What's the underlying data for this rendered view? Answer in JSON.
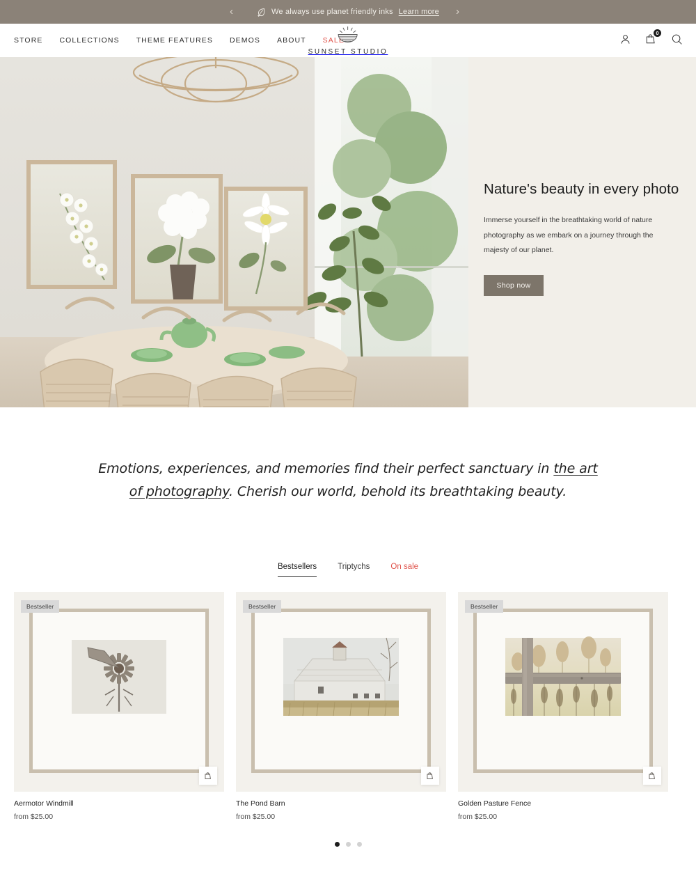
{
  "announcement": {
    "icon": "leaf-icon",
    "text": "We always use planet friendly inks",
    "link_label": "Learn more",
    "prev": "‹",
    "next": "›",
    "bg_color": "#8b8278"
  },
  "header": {
    "nav": [
      {
        "label": "STORE"
      },
      {
        "label": "COLLECTIONS"
      },
      {
        "label": "THEME FEATURES"
      },
      {
        "label": "DEMOS"
      },
      {
        "label": "ABOUT"
      },
      {
        "label": "SALE",
        "accent": "#e0544c"
      }
    ],
    "brand": {
      "name": "SUNSET STUDIO",
      "logo_icon": "sunset-logo-icon"
    },
    "actions": {
      "account_icon": "account-icon",
      "cart_icon": "cart-icon",
      "cart_count": "0",
      "search_icon": "search-icon"
    }
  },
  "hero": {
    "image_alt": "Dining room with three framed white flower photographs, rattan chairs and a green plant by the window",
    "title": "Nature's beauty in every photo",
    "subtitle": "Immerse yourself in the breathtaking world of nature photography as we embark on a journey through the majesty of our planet.",
    "cta_label": "Shop now",
    "bg_color": "#f2efe9",
    "cta_color": "#7d756a"
  },
  "quote": {
    "part1": "Emotions, experiences, and memories find their perfect sanctuary in ",
    "underlined": "the art of photography",
    "part2": ". Cherish our world, behold its breathtaking beauty."
  },
  "tabs": [
    {
      "label": "Bestsellers",
      "active": true
    },
    {
      "label": "Triptychs",
      "active": false
    },
    {
      "label": "On sale",
      "active": false,
      "accent": "#e0544c"
    }
  ],
  "products": [
    {
      "badge": "Bestseller",
      "title": "Aermotor Windmill",
      "price": "from $25.00",
      "image_alt": "Framed photograph of a vintage metal windmill against a pale sky",
      "quick_add_icon": "quick-add-cart-icon"
    },
    {
      "badge": "Bestseller",
      "title": "The Pond Barn",
      "price": "from $25.00",
      "image_alt": "Framed photograph of a weathered white barn behind a golden reed field",
      "quick_add_icon": "quick-add-cart-icon"
    },
    {
      "badge": "Bestseller",
      "title": "Golden Pasture Fence",
      "price": "from $25.00",
      "image_alt": "Framed photograph of a wooden pasture fence with dried grasses in golden light",
      "quick_add_icon": "quick-add-cart-icon"
    }
  ],
  "carousel": {
    "dots": 3,
    "active_index": 0
  }
}
